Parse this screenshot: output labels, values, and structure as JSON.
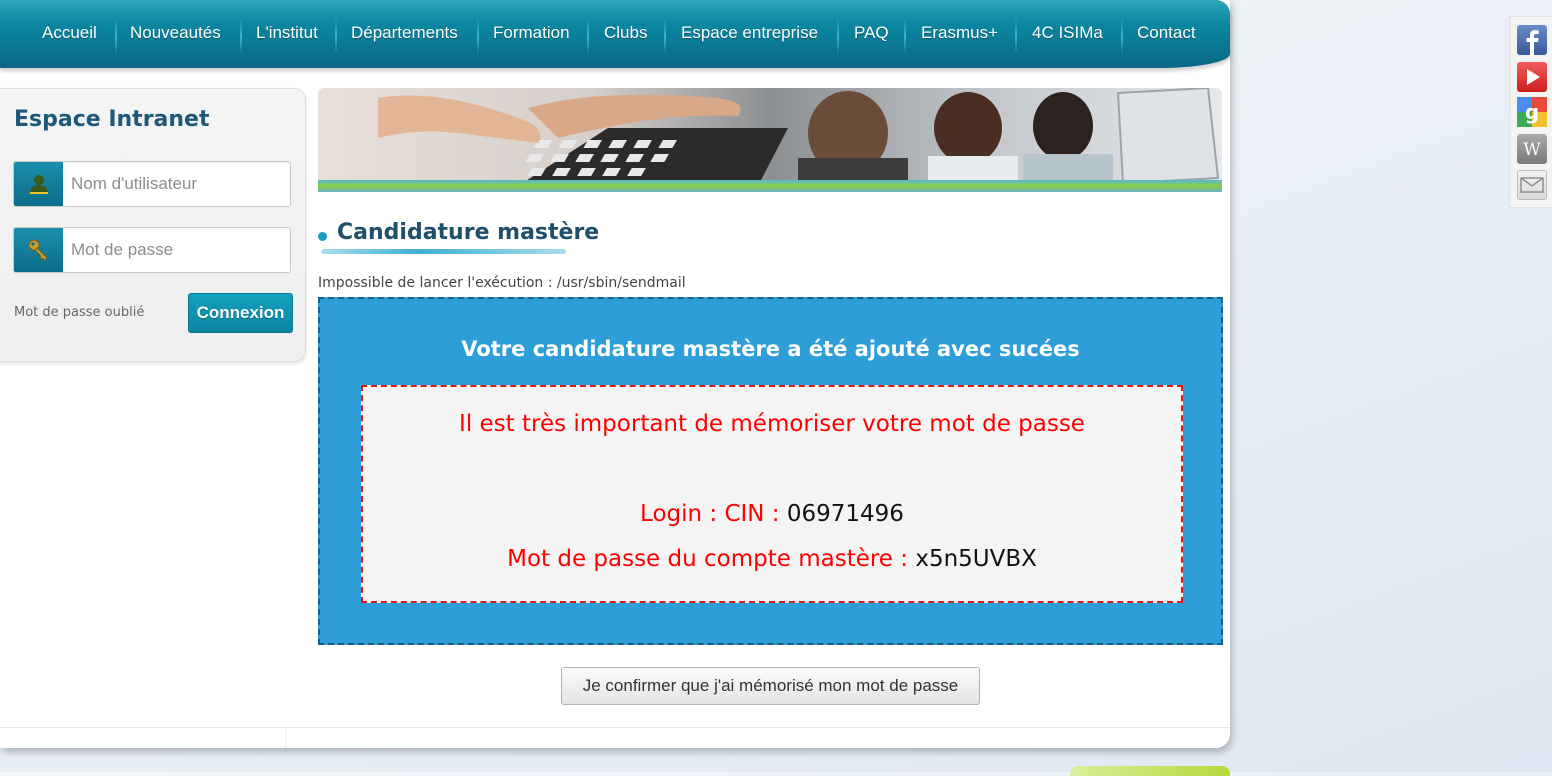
{
  "nav": {
    "items": [
      "Accueil",
      "Nouveautés",
      "L'institut",
      "Départements",
      "Formation",
      "Clubs",
      "Espace entreprise",
      "PAQ",
      "Erasmus+",
      "4C ISIMa",
      "Contact"
    ]
  },
  "login": {
    "title": "Espace Intranet",
    "username_placeholder": "Nom d'utilisateur",
    "password_placeholder": "Mot de passe",
    "forgot_label": "Mot de passe oublié",
    "submit_label": "Connexion"
  },
  "main": {
    "heading": "Candidature mastère",
    "error_message": "Impossible de lancer l'exécution : /usr/sbin/sendmail",
    "success_title": "Votre candidature mastère a été ajouté avec sucées",
    "warning": "Il est très important de mémoriser votre mot de passe",
    "login_label": "Login : CIN :",
    "login_value": "06971496",
    "password_label": "Mot de passe du compte mastère :",
    "password_value": "x5n5UVBX",
    "confirm_label": "Je confirmer que j'ai mémorisé mon mot de passe"
  },
  "social": {
    "icons": [
      "facebook-icon",
      "youtube-icon",
      "google-icon",
      "wikipedia-icon",
      "mail-icon"
    ]
  },
  "colors": {
    "nav_bg": "#0b7e99",
    "success_bg": "#2e9ed9",
    "warning_text": "#ff0000",
    "heading": "#1f4f6a"
  }
}
